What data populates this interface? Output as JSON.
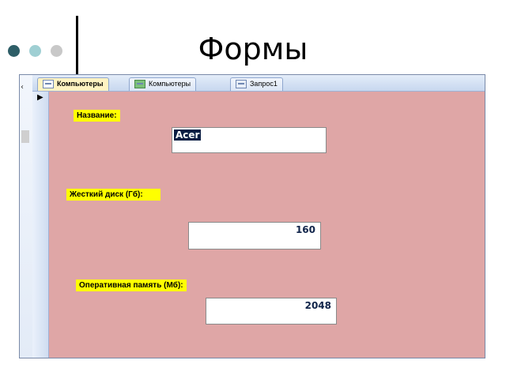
{
  "slide": {
    "title": "Формы"
  },
  "tabs": [
    {
      "label": "Компьютеры",
      "icon": "form-icon",
      "active": true
    },
    {
      "label": "Компьютеры",
      "icon": "table-icon",
      "active": false
    },
    {
      "label": "Запрос1",
      "icon": "query-icon",
      "active": false
    }
  ],
  "form": {
    "fields": [
      {
        "label": "Название:",
        "value": "Acer"
      },
      {
        "label": "Жесткий диск (Гб):",
        "value": "160"
      },
      {
        "label": "Оперативная память (Мб):",
        "value": "2048"
      }
    ],
    "background_color": "#dfa6a6",
    "label_color": "#ffff00"
  }
}
